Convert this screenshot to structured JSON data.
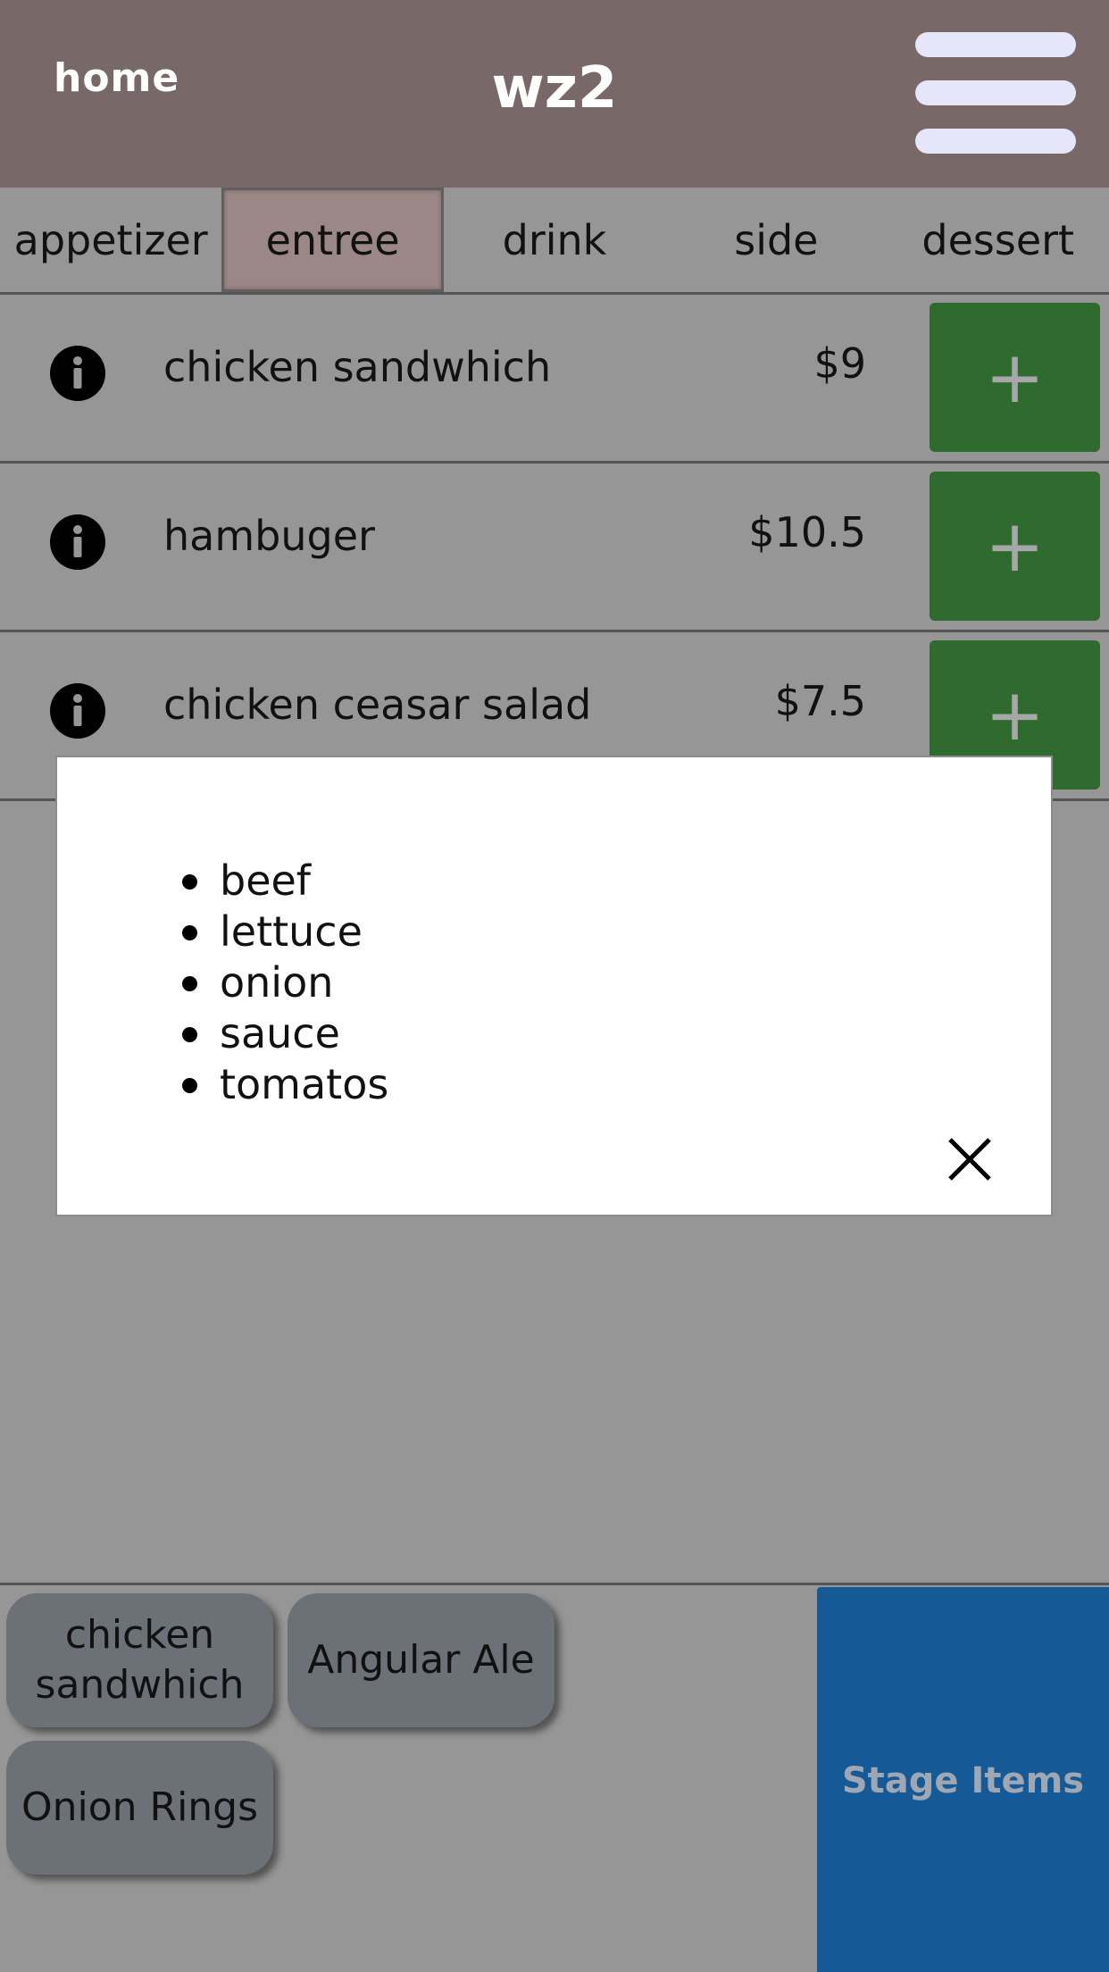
{
  "header": {
    "home_label": "home",
    "title": "wz2",
    "menu_icon": "hamburger-menu-icon"
  },
  "tabs": [
    {
      "label": "appetizer",
      "active": false
    },
    {
      "label": "entree",
      "active": true
    },
    {
      "label": "drink",
      "active": false
    },
    {
      "label": "side",
      "active": false
    },
    {
      "label": "dessert",
      "active": false
    }
  ],
  "menu_items": [
    {
      "name": "chicken sandwhich",
      "price": "$9",
      "add_label": "+"
    },
    {
      "name": "hambuger",
      "price": "$10.5",
      "add_label": "+"
    },
    {
      "name": "chicken ceasar salad",
      "price": "$7.5",
      "add_label": "+"
    }
  ],
  "modal": {
    "ingredients": [
      "beef",
      "lettuce",
      "onion",
      "sauce",
      "tomatos"
    ],
    "close_icon": "close-icon"
  },
  "staged_items": [
    {
      "label": "chicken sandwhich"
    },
    {
      "label": "Angular Ale"
    },
    {
      "label": "Onion Rings"
    }
  ],
  "stage_button_label": "Stage Items",
  "colors": {
    "header_bg": "#786868",
    "page_bg": "#969696",
    "active_tab_bg": "#9c8787",
    "add_button_bg": "#2f6b2f",
    "chip_bg": "#6c7077",
    "stage_button_bg": "#155a96",
    "hamburger_bar": "#e6e6fa"
  }
}
